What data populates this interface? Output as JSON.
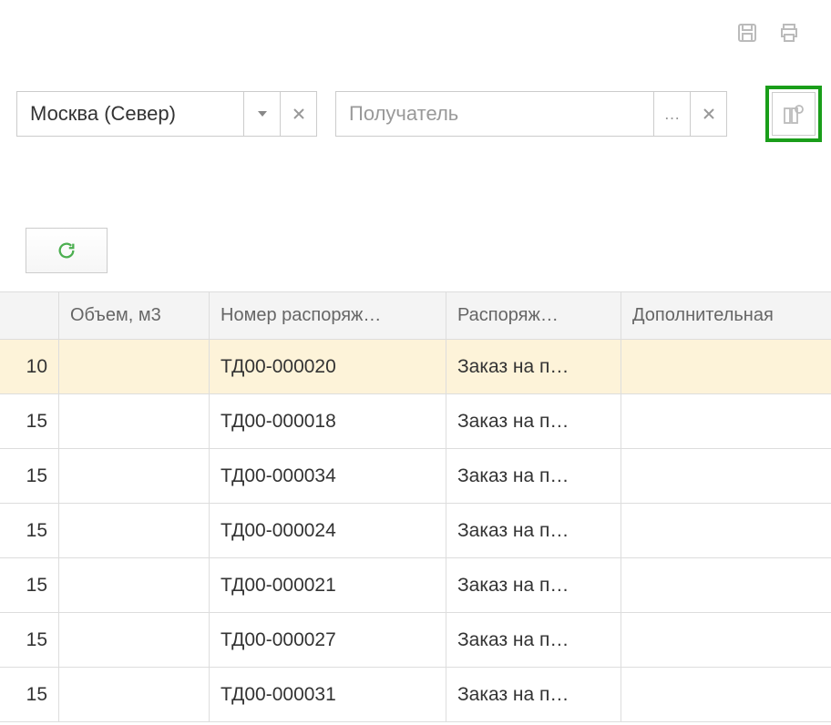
{
  "filter": {
    "zone_value": "Москва (Север)",
    "recipient_placeholder": "Получатель"
  },
  "table": {
    "headers": {
      "col0": "",
      "col1": "Объем, м3",
      "col2": "Номер распоряж…",
      "col3": "Распоряж…",
      "col4": "Дополнительная"
    },
    "rows": [
      {
        "c0": "10",
        "c1": "",
        "c2": "ТД00-000020",
        "c3": "Заказ на п…",
        "c4": "",
        "selected": true
      },
      {
        "c0": "15",
        "c1": "",
        "c2": "ТД00-000018",
        "c3": "Заказ на п…",
        "c4": ""
      },
      {
        "c0": "15",
        "c1": "",
        "c2": "ТД00-000034",
        "c3": "Заказ на п…",
        "c4": ""
      },
      {
        "c0": "15",
        "c1": "",
        "c2": "ТД00-000024",
        "c3": "Заказ на п…",
        "c4": ""
      },
      {
        "c0": "15",
        "c1": "",
        "c2": "ТД00-000021",
        "c3": "Заказ на п…",
        "c4": ""
      },
      {
        "c0": "15",
        "c1": "",
        "c2": "ТД00-000027",
        "c3": "Заказ на п…",
        "c4": ""
      },
      {
        "c0": "15",
        "c1": "",
        "c2": "ТД00-000031",
        "c3": "Заказ на п…",
        "c4": ""
      }
    ]
  }
}
